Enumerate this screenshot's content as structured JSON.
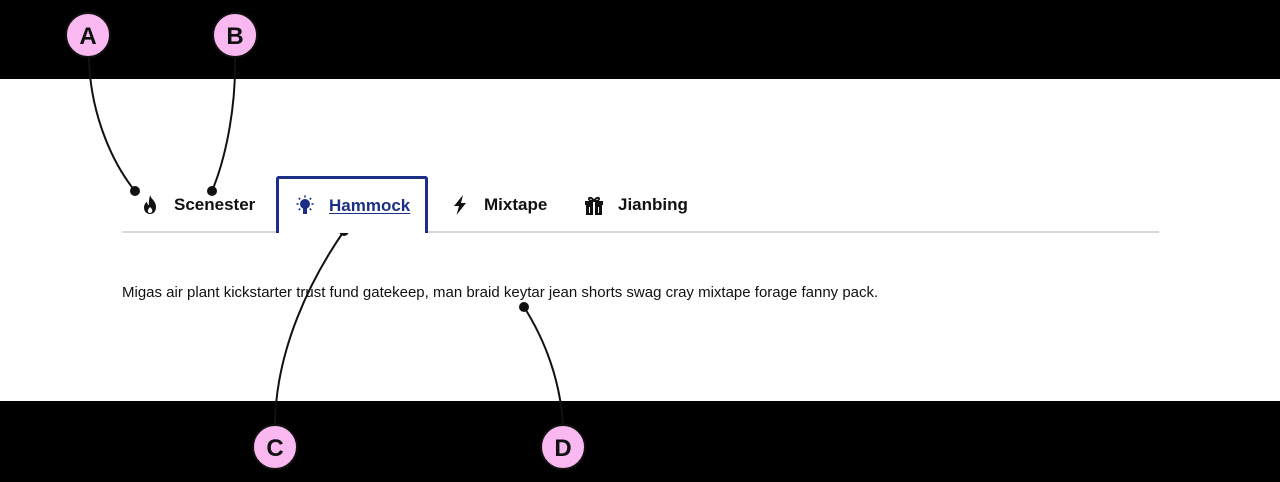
{
  "tabs": [
    {
      "label": "Scenester",
      "icon": "flame-icon",
      "selected": false
    },
    {
      "label": "Hammock",
      "icon": "lightbulb-icon",
      "selected": true
    },
    {
      "label": "Mixtape",
      "icon": "lightning-bolt-icon",
      "selected": false
    },
    {
      "label": "Jianbing",
      "icon": "gift-icon",
      "selected": false
    }
  ],
  "panel": {
    "text": "Migas air plant kickstarter trust fund gatekeep, man braid keytar jean shorts swag cray mixtape forage fanny pack."
  },
  "callouts": {
    "a": "A",
    "b": "B",
    "c": "C",
    "d": "D"
  },
  "colors": {
    "accent": "#1b2f86",
    "callout_fill": "#f9b8f0",
    "divider": "#d7d7d7",
    "backdrop": "#000000"
  }
}
